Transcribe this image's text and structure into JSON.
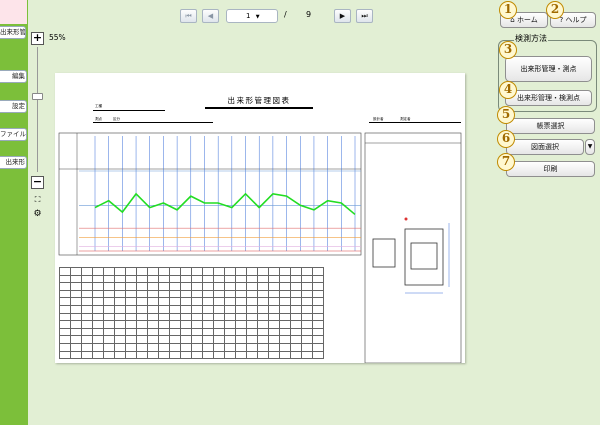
{
  "sidebar": {
    "items": [
      {
        "label": "出来形管理"
      },
      {
        "label": "編集"
      },
      {
        "label": "設定"
      },
      {
        "label": "ファイル"
      },
      {
        "label": "出来形"
      }
    ]
  },
  "pager": {
    "first": "⏮",
    "prev": "◀",
    "current_page": "1",
    "separator": "/",
    "total_pages": "9",
    "next": "▶",
    "last": "⏭"
  },
  "zoom": {
    "level": "55%",
    "plus": "+",
    "minus": "−",
    "fit": "⛶",
    "settings": "⚙",
    "slider_value": 0.6
  },
  "document": {
    "title": "出来形管理図表",
    "fields": [
      "工種",
      "測点",
      "区分",
      "設計者",
      "測定者"
    ]
  },
  "chart_data": {
    "type": "line",
    "xlabel": "",
    "ylabel": "",
    "x": [
      1,
      2,
      3,
      4,
      5,
      6,
      7,
      8,
      9,
      10,
      11,
      12,
      13,
      14,
      15,
      16,
      17,
      18,
      19,
      20
    ],
    "series": [
      {
        "values": [
          -1,
          2,
          -3,
          5,
          -1,
          1,
          -2,
          4,
          1,
          1,
          -1,
          5,
          -1,
          5,
          4,
          0,
          -2,
          2,
          1,
          -4
        ]
      }
    ],
    "ylim": [
      -20,
      15
    ],
    "grid": true
  },
  "right_panel": {
    "home_label": "ホーム",
    "help_label": "ヘルプ",
    "inspect_title": "検測方法",
    "survey_point_label": "出来形管理・測点",
    "inspect_point_label": "出来形管理・検測点",
    "form_select_label": "帳票選択",
    "drawing_select_label": "図面選択",
    "print_label": "印刷",
    "badges": [
      "1",
      "2",
      "3",
      "4",
      "5",
      "6",
      "7"
    ]
  },
  "colors": {
    "accent_green": "#7cbf3a",
    "panel_bg": "#e2efd4",
    "badge_gold": "#c08a00",
    "series_line": "#22dd22"
  }
}
